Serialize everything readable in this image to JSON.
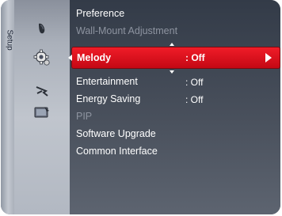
{
  "sidebar": {
    "tab_label": "Setup"
  },
  "icons": [
    "picture-icon",
    "setup-gear-icon",
    "input-antenna-icon",
    "application-icon"
  ],
  "menu": {
    "items": [
      {
        "label": "Preference",
        "value": "",
        "enabled": true
      },
      {
        "label": "Wall-Mount Adjustment",
        "value": "",
        "enabled": false
      },
      {
        "label": "Melody",
        "value": ": Off",
        "enabled": true,
        "selected": true
      },
      {
        "label": "Entertainment",
        "value": ": Off",
        "enabled": true
      },
      {
        "label": "Energy Saving",
        "value": ": Off",
        "enabled": true
      },
      {
        "label": "PIP",
        "value": "",
        "enabled": false
      },
      {
        "label": "Software Upgrade",
        "value": "",
        "enabled": true
      },
      {
        "label": "Common Interface",
        "value": "",
        "enabled": true
      }
    ]
  },
  "colors": {
    "highlight": "#e3141f",
    "panel": "#3f4653",
    "disabled_text": "#8e94a0"
  }
}
